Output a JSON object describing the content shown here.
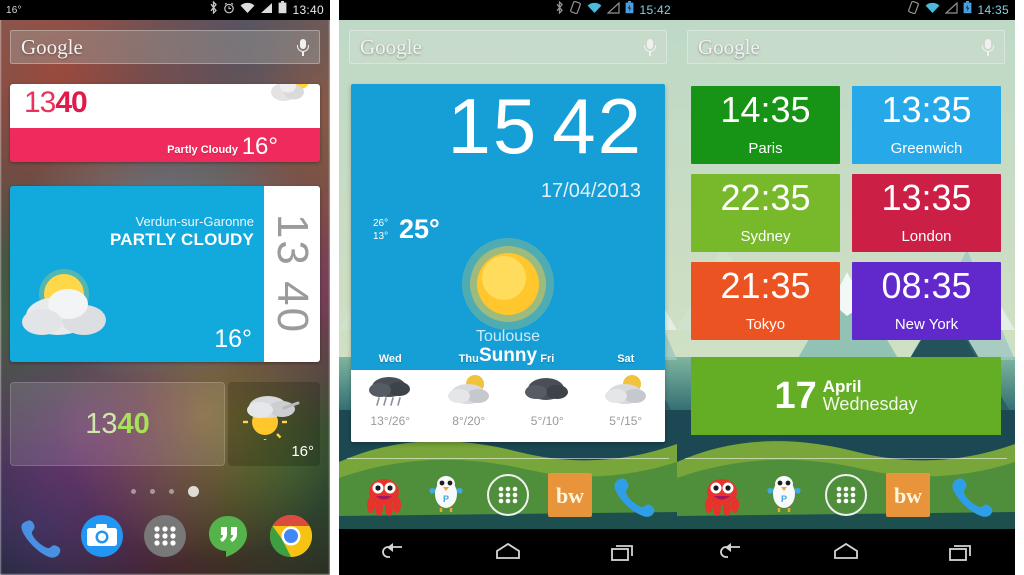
{
  "panels": [
    {
      "id": "panel-one",
      "status": {
        "left_temp": "16°",
        "clock": "13:40",
        "icons": [
          "bluetooth-icon",
          "alarm-icon",
          "wifi-icon",
          "signal-icon",
          "battery-icon"
        ]
      },
      "search": {
        "label": "Google",
        "mic": "microphone-icon"
      },
      "widget_flat_clock": {
        "hour": "13",
        "minute": "40",
        "condition": "Partly Cloudy",
        "temp": "16°",
        "icon": "partly-cloudy-icon"
      },
      "widget_weather_card": {
        "location": "Verdun-sur-Garonne",
        "condition": "PARTLY CLOUDY",
        "temp": "16°",
        "icon": "partly-cloudy-icon",
        "side_hour": "13",
        "side_minute": "40"
      },
      "widget_transparent": {
        "hour": "13",
        "minute": "40",
        "temp": "16°",
        "icon": "sun-behind-cloud-icon"
      },
      "page_dots": {
        "count": 4,
        "active_index": 3
      },
      "dock": [
        {
          "name": "phone",
          "icon": "phone-icon"
        },
        {
          "name": "camera",
          "icon": "camera-icon"
        },
        {
          "name": "all-apps",
          "icon": "app-drawer-icon"
        },
        {
          "name": "hangouts",
          "icon": "hangouts-icon"
        },
        {
          "name": "chrome",
          "icon": "chrome-icon"
        }
      ]
    },
    {
      "id": "panel-two",
      "status": {
        "clock": "15:42",
        "icons": [
          "bluetooth-icon",
          "rotation-icon",
          "wifi-icon",
          "signal-icon",
          "battery-charging-icon"
        ]
      },
      "search": {
        "label": "Google",
        "mic": "microphone-icon"
      },
      "widget_big_weather": {
        "hour": "15",
        "minute": "42",
        "date": "17/04/2013",
        "high": "26°",
        "low": "13°",
        "current": "25°",
        "location": "Toulouse",
        "condition": "Sunny",
        "icon": "sun-icon",
        "forecast": [
          {
            "day": "Wed",
            "temps": "13°/26°",
            "icon": "rain-icon"
          },
          {
            "day": "Thu",
            "temps": "8°/20°",
            "icon": "partly-cloudy-icon"
          },
          {
            "day": "Fri",
            "temps": "5°/10°",
            "icon": "cloudy-icon"
          },
          {
            "day": "Sat",
            "temps": "5°/15°",
            "icon": "partly-cloudy-icon"
          }
        ]
      },
      "dock": [
        {
          "name": "octopus-app",
          "icon": "octopus-icon"
        },
        {
          "name": "plume-twitter",
          "icon": "bird-icon"
        },
        {
          "name": "all-apps",
          "icon": "app-drawer-icon"
        },
        {
          "name": "beautiful-widgets",
          "icon": "bw-icon",
          "label": "bw"
        },
        {
          "name": "phone",
          "icon": "phone-icon"
        }
      ],
      "navbar": [
        "back-icon",
        "home-icon",
        "recents-icon"
      ]
    },
    {
      "id": "panel-three",
      "status": {
        "clock": "14:35",
        "icons": [
          "rotation-icon",
          "wifi-icon",
          "signal-icon",
          "battery-charging-icon"
        ]
      },
      "search": {
        "label": "Google",
        "mic": "microphone-icon"
      },
      "world_clocks": [
        {
          "time": "14:35",
          "city": "Paris",
          "color": "#179416"
        },
        {
          "time": "13:35",
          "city": "Greenwich",
          "color": "#27a8e8"
        },
        {
          "time": "22:35",
          "city": "Sydney",
          "color": "#77b92a"
        },
        {
          "time": "13:35",
          "city": "London",
          "color": "#cc1f46"
        },
        {
          "time": "21:35",
          "city": "Tokyo",
          "color": "#ec5323"
        },
        {
          "time": "08:35",
          "city": "New York",
          "color": "#6129cb"
        }
      ],
      "date_widget": {
        "day": "17",
        "month": "April",
        "weekday": "Wednesday",
        "color": "#64ae26"
      },
      "dock": [
        {
          "name": "octopus-app",
          "icon": "octopus-icon"
        },
        {
          "name": "plume-twitter",
          "icon": "bird-icon"
        },
        {
          "name": "all-apps",
          "icon": "app-drawer-icon"
        },
        {
          "name": "beautiful-widgets",
          "icon": "bw-icon",
          "label": "bw"
        },
        {
          "name": "phone",
          "icon": "phone-icon"
        }
      ],
      "navbar": [
        "back-icon",
        "home-icon",
        "recents-icon"
      ]
    }
  ]
}
